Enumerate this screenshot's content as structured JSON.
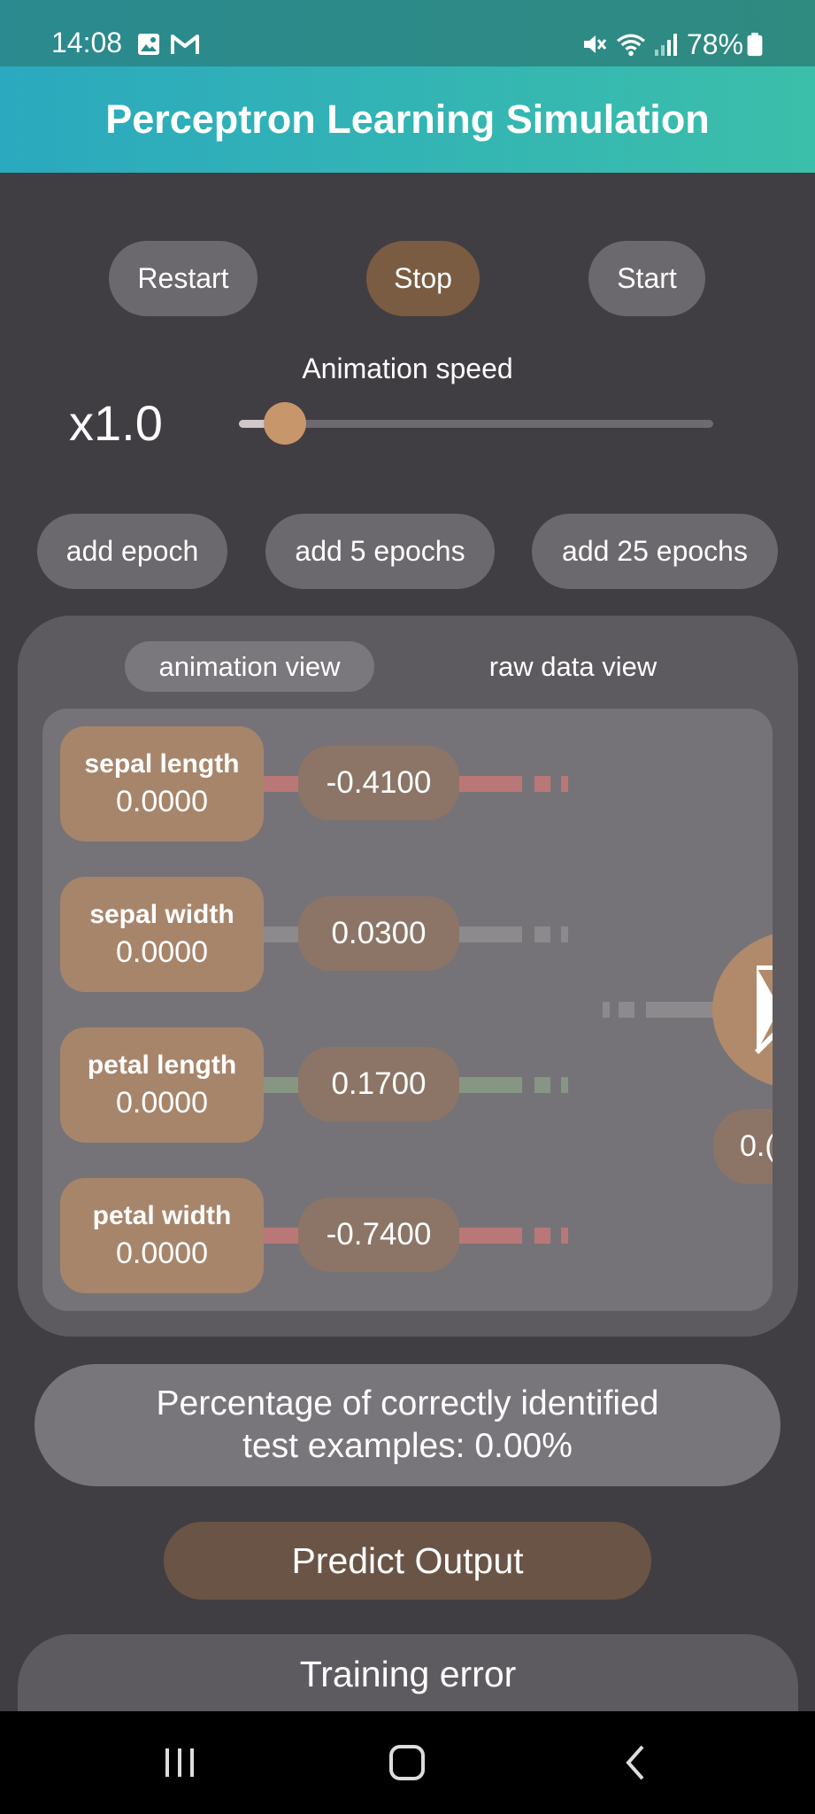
{
  "status_bar": {
    "time": "14:08",
    "battery": "78%",
    "icons": [
      "gallery-icon",
      "gmail-icon",
      "mute-icon",
      "wifi-icon",
      "signal-icon",
      "battery-icon"
    ]
  },
  "app_bar": {
    "title": "Perceptron Learning Simulation"
  },
  "controls": {
    "restart_label": "Restart",
    "stop_label": "Stop",
    "start_label": "Start"
  },
  "speed": {
    "label": "Animation speed",
    "value_text": "x1.0",
    "slider_fraction": 0.1
  },
  "epochs": {
    "add_1": "add epoch",
    "add_5": "add 5 epochs",
    "add_25": "add 25 epochs"
  },
  "tabs": {
    "animation": "animation view",
    "raw": "raw data view",
    "active": "animation"
  },
  "features": [
    {
      "name": "sepal length",
      "value": "0.0000",
      "weight": "-0.4100",
      "conn_color": "#b97877"
    },
    {
      "name": "sepal width",
      "value": "0.0000",
      "weight": "0.0300",
      "conn_color": "#8c8a8c"
    },
    {
      "name": "petal length",
      "value": "0.0000",
      "weight": "0.1700",
      "conn_color": "#869683"
    },
    {
      "name": "petal width",
      "value": "0.0000",
      "weight": "-0.7400",
      "conn_color": "#b97877"
    }
  ],
  "output": {
    "text": "0.("
  },
  "accuracy": {
    "line1": "Percentage of correctly identified",
    "line2": "test examples: 0.00%"
  },
  "predict_label": "Predict Output",
  "training_error_label": "Training error",
  "colors": {
    "background": "#413e43",
    "accent": "#c8966b",
    "teal": "#2ba9be"
  }
}
